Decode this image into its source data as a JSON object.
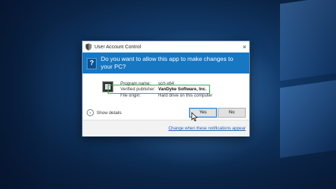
{
  "dialog": {
    "title": "User Account Control",
    "close_glyph": "×",
    "question": "Do you want to allow this app to make changes to your PC?",
    "question_icon": "?",
    "program_name_label": "Program name:",
    "program_name_value": "scrt-x64",
    "publisher_label": "Verified publisher:",
    "publisher_value": "VanDyke Software, Inc.",
    "origin_label": "File origin:",
    "origin_value": "Hard drive on this computer",
    "show_details": "Show details",
    "yes_label": "Yes",
    "no_label": "No",
    "change_link": "Change when these notifications appear"
  },
  "colors": {
    "banner": "#1777c2",
    "highlight": "#2fa84f",
    "link": "#1a5fb4"
  }
}
